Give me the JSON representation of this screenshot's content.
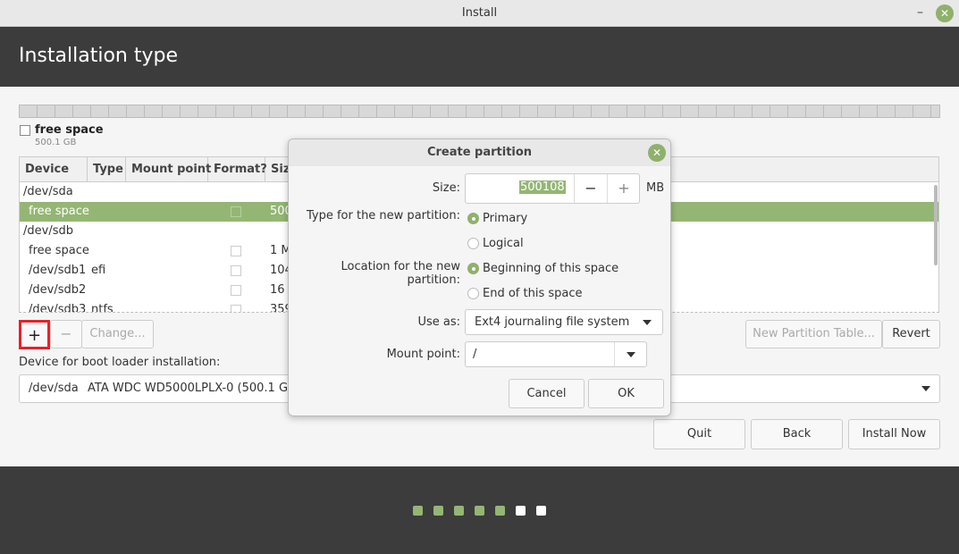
{
  "window": {
    "title": "Install",
    "minimize_icon": "minimize-icon",
    "close_icon": "close-icon"
  },
  "header": {
    "title": "Installation type"
  },
  "disk": {
    "label": "free space",
    "size": "500.1 GB"
  },
  "table": {
    "columns": [
      "Device",
      "Type",
      "Mount point",
      "Format?",
      "Size"
    ],
    "rows": [
      {
        "device": "/dev/sda",
        "type": "",
        "size": "",
        "group": true
      },
      {
        "device": "free space",
        "type": "",
        "size": "500",
        "selected": true
      },
      {
        "device": "/dev/sdb",
        "type": "",
        "size": "",
        "group": true
      },
      {
        "device": "free space",
        "type": "",
        "size": "1 M"
      },
      {
        "device": "/dev/sdb1",
        "type": "efi",
        "size": "104"
      },
      {
        "device": "/dev/sdb2",
        "type": "",
        "size": "16 i"
      },
      {
        "device": "/dev/sdb3",
        "type": "ntfs",
        "size": "359"
      }
    ]
  },
  "buttons": {
    "add": "+",
    "remove": "−",
    "change": "Change...",
    "new_table": "New Partition Table...",
    "revert": "Revert",
    "quit": "Quit",
    "back": "Back",
    "install": "Install Now"
  },
  "bootloader": {
    "label": "Device for boot loader installation:",
    "device": "/dev/sda",
    "desc": "ATA WDC WD5000LPLX-0 (500.1 GB)"
  },
  "dialog": {
    "title": "Create partition",
    "size_label": "Size:",
    "size_value": "500108",
    "size_unit": "MB",
    "minus": "−",
    "plus": "+",
    "type_label": "Type for the new partition:",
    "type_options": [
      "Primary",
      "Logical"
    ],
    "type_selected": "Primary",
    "location_label": "Location for the new partition:",
    "location_options": [
      "Beginning of this space",
      "End of this space"
    ],
    "location_selected": "Beginning of this space",
    "use_as_label": "Use as:",
    "use_as_value": "Ext4 journaling file system",
    "mount_label": "Mount point:",
    "mount_value": "/",
    "cancel": "Cancel",
    "ok": "OK"
  },
  "progress": {
    "total_steps": 7,
    "completed_steps": 5
  },
  "colors": {
    "accent": "#94b674",
    "header": "#3c3c3c",
    "highlight": "#e8202a"
  }
}
